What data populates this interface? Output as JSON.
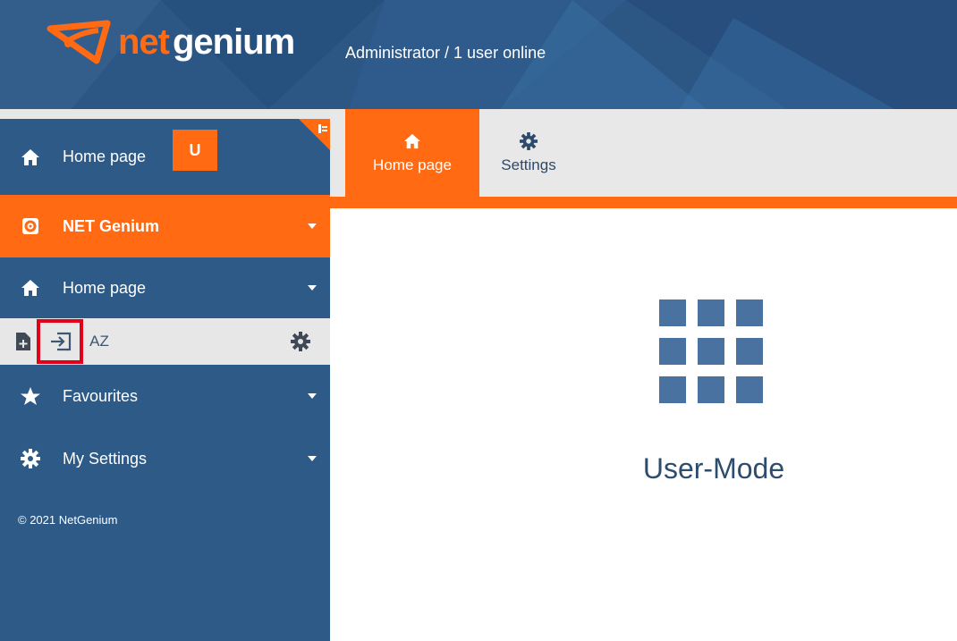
{
  "header": {
    "logo_part1": "net",
    "logo_part2": "genium",
    "user_status": "Administrator / 1 user online"
  },
  "sidebar": {
    "home_label": "Home page",
    "badge": "U",
    "items": [
      {
        "label": "NET Genium",
        "icon": "gear-badge-icon",
        "active": true
      },
      {
        "label": "Home page",
        "icon": "home-icon",
        "active": false
      },
      {
        "label": "Favourites",
        "icon": "star-icon",
        "active": false
      },
      {
        "label": "My Settings",
        "icon": "gear-icon",
        "active": false
      }
    ],
    "toolbar": {
      "icons": [
        "add-page-icon",
        "enter-icon",
        "sort-az-icon",
        "gear-icon"
      ],
      "sort_label": "AZ"
    },
    "copyright": "© 2021 NetGenium"
  },
  "tabs": [
    {
      "label": "Home page",
      "icon": "home-icon",
      "active": true
    },
    {
      "label": "Settings",
      "icon": "gear-icon",
      "active": false
    }
  ],
  "main": {
    "mode_label": "User-Mode",
    "icon": "grid-icon"
  },
  "colors": {
    "accent": "#ff6a13",
    "sidebar": "#2d5a87",
    "header": "#2c5684",
    "highlight": "#e2001a"
  }
}
